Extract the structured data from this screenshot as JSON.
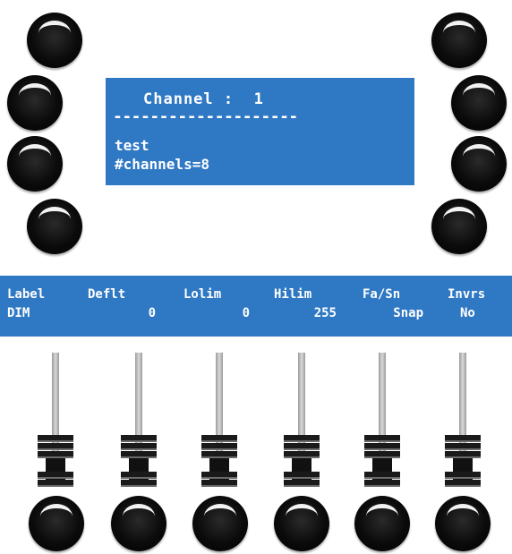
{
  "display": {
    "title": "Channel :  1",
    "separator": "--------------------",
    "line1": "test",
    "line2": "#channels=8"
  },
  "params": [
    {
      "header": "Label",
      "value": "DIM",
      "align": "left"
    },
    {
      "header": "Deflt",
      "value": "0",
      "align": "right"
    },
    {
      "header": "Lolim",
      "value": "0",
      "align": "right"
    },
    {
      "header": "Hilim",
      "value": "255",
      "align": "right"
    },
    {
      "header": "Fa/Sn",
      "value": "Snap",
      "align": "right"
    },
    {
      "header": "Invrs",
      "value": "No",
      "align": "left"
    }
  ],
  "colors": {
    "lcd_background": "#2f78c4",
    "lcd_text": "#ffffff",
    "knob": "#000000"
  }
}
